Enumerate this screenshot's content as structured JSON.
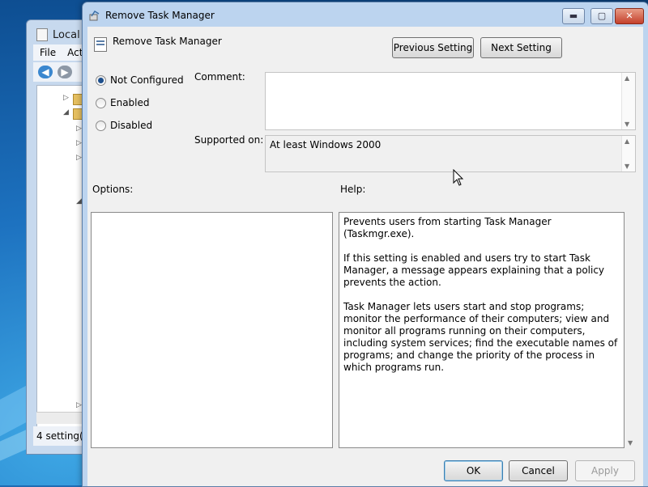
{
  "background_window": {
    "title": "Local G",
    "menu": [
      "File",
      "Act"
    ],
    "status": "4 setting(s"
  },
  "dialog": {
    "title": "Remove Task Manager",
    "header_title": "Remove Task Manager",
    "buttons": {
      "previous": "Previous Setting",
      "next": "Next Setting",
      "ok": "OK",
      "cancel": "Cancel",
      "apply": "Apply"
    },
    "radios": [
      {
        "label": "Not Configured",
        "checked": true
      },
      {
        "label": "Enabled",
        "checked": false
      },
      {
        "label": "Disabled",
        "checked": false
      }
    ],
    "comment_label": "Comment:",
    "comment_value": "",
    "supported_label": "Supported on:",
    "supported_value": "At least Windows 2000",
    "options_label": "Options:",
    "help_label": "Help:",
    "help_paragraphs": [
      "Prevents users from starting Task Manager (Taskmgr.exe).",
      "If this setting is enabled and users try to start Task Manager, a message appears explaining that a policy prevents the action.",
      "Task Manager lets users start and stop programs; monitor the performance of their computers; view and monitor all programs running on their computers, including system services; find the executable names of programs; and change the priority of the process in which programs run."
    ],
    "window_controls": {
      "minimize": "▬",
      "maximize": "▢",
      "close": "✕"
    }
  },
  "colors": {
    "accent": "#1d4f8c",
    "titlebar": "#bcd4ef",
    "close": "#c4402c"
  }
}
